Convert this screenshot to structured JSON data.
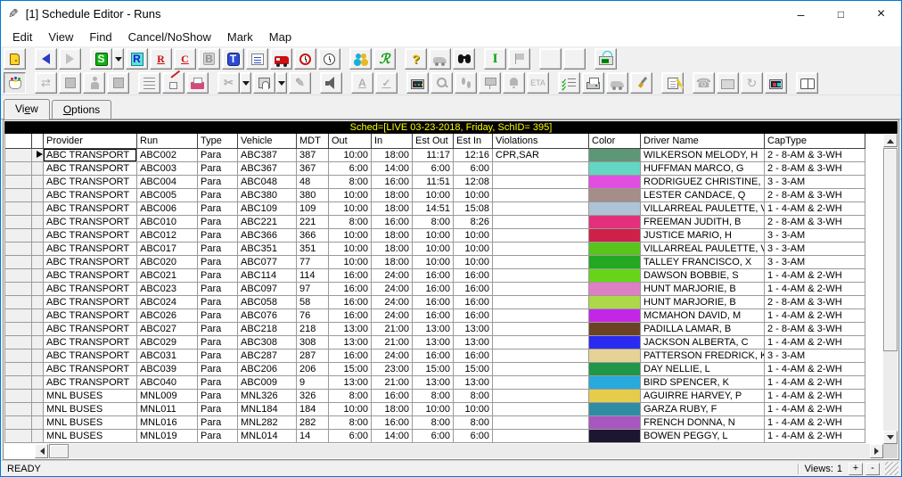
{
  "window": {
    "title": "[1] Schedule Editor - Runs",
    "controls": {
      "minimize": "–",
      "maximize": "□",
      "close": "×"
    }
  },
  "menu": [
    "Edit",
    "View",
    "Find",
    "Cancel/NoShow",
    "Mark",
    "Map"
  ],
  "toolbar_main": [
    {
      "name": "exit-button",
      "icon": "door"
    },
    {
      "name": "back-button",
      "icon": "arrow-left",
      "gap": true
    },
    {
      "name": "forward-button",
      "icon": "arrow-right",
      "enabled": false
    },
    {
      "name": "schedules-button",
      "icon": "letter-s",
      "text": "S",
      "gap": true,
      "dropdown": true
    },
    {
      "name": "runs-button",
      "icon": "letter-r-blue",
      "text": "R"
    },
    {
      "name": "run-list-button",
      "icon": "letter-r-red",
      "text": "R"
    },
    {
      "name": "cancellations-button",
      "icon": "letter-c-red",
      "text": "C"
    },
    {
      "name": "bookings-button",
      "icon": "letter-b-gray",
      "text": "B",
      "enabled": false
    },
    {
      "name": "trips-button",
      "icon": "letter-t-blue",
      "text": "T"
    },
    {
      "name": "itinerary-button",
      "icon": "list-lines"
    },
    {
      "name": "vehicles-button",
      "icon": "bus-red"
    },
    {
      "name": "alarms-button",
      "icon": "alarm-clock"
    },
    {
      "name": "clock-button",
      "icon": "clock"
    },
    {
      "name": "clients-button",
      "icon": "people",
      "gap": true
    },
    {
      "name": "reports-button",
      "icon": "script-r",
      "text": "ℛ"
    },
    {
      "name": "help-button",
      "icon": "question",
      "text": "?",
      "gap": true
    },
    {
      "name": "vehicle-locate-button",
      "icon": "car-gray",
      "enabled": false
    },
    {
      "name": "find-button",
      "icon": "binoculars"
    },
    {
      "name": "info-button",
      "icon": "letter-i-green",
      "text": "I",
      "gap": true
    },
    {
      "name": "flag-button",
      "icon": "flag-gray",
      "enabled": false
    },
    {
      "name": "fixed-route-button",
      "icon": "bus-gray",
      "enabled": false,
      "gap": true
    },
    {
      "name": "fixed-route-2-button",
      "icon": "bus-gray",
      "enabled": false
    },
    {
      "name": "mdt-button",
      "icon": "mdt-radio",
      "gap": true
    }
  ],
  "toolbar_secondary": [
    {
      "name": "color-legend-button",
      "icon": "palette",
      "pressed": true
    },
    {
      "name": "swap-button",
      "icon": "swap-arrows",
      "text": "⇄",
      "enabled": false,
      "gap": true
    },
    {
      "name": "block-button",
      "icon": "square-gray",
      "enabled": false
    },
    {
      "name": "driver-button",
      "icon": "person-gray",
      "enabled": false
    },
    {
      "name": "block-2-button",
      "icon": "square-gray",
      "enabled": false
    },
    {
      "name": "run-times-button",
      "icon": "times-list",
      "gap": true
    },
    {
      "name": "ink-button",
      "icon": "ink-pen"
    },
    {
      "name": "send-button",
      "icon": "fax-pink"
    },
    {
      "name": "cut-run-button",
      "icon": "scissors-gray",
      "text": "✂",
      "enabled": false,
      "gap": true,
      "dropdown": true
    },
    {
      "name": "save-button",
      "icon": "save",
      "dropdown": true
    },
    {
      "name": "edit-button",
      "icon": "pencil-gray",
      "text": "✎",
      "enabled": false
    },
    {
      "name": "sound-button",
      "icon": "speaker",
      "gap": true
    },
    {
      "name": "address-list-button",
      "icon": "list-a-gray",
      "text": "A",
      "enabled": false,
      "gap": true
    },
    {
      "name": "validation-button",
      "icon": "list-check-gray",
      "text": "✓",
      "enabled": false
    },
    {
      "name": "monitor-button",
      "icon": "monitor-dots",
      "gap": true
    },
    {
      "name": "zoom-button",
      "icon": "magnifier-gray",
      "enabled": false
    },
    {
      "name": "walk-button",
      "icon": "footprints-gray",
      "enabled": false
    },
    {
      "name": "stop-button",
      "icon": "signpost-gray",
      "enabled": false
    },
    {
      "name": "notify-button",
      "icon": "bell-gray",
      "enabled": false
    },
    {
      "name": "eta-button",
      "icon": "eta-text",
      "text": "ETA",
      "enabled": false
    },
    {
      "name": "checklist-button",
      "icon": "checklist",
      "gap": true
    },
    {
      "name": "print-button",
      "icon": "printer"
    },
    {
      "name": "vehicle-2-button",
      "icon": "car-gray",
      "enabled": false
    },
    {
      "name": "brush-button",
      "icon": "brush"
    },
    {
      "name": "notes-button",
      "icon": "notepad",
      "gap": true
    },
    {
      "name": "phone-button",
      "icon": "phone-gray",
      "text": "☎",
      "enabled": false,
      "gap": true
    },
    {
      "name": "monitor-2-button",
      "icon": "monitor-gray",
      "enabled": false
    },
    {
      "name": "history-button",
      "icon": "clock-arrow-gray",
      "text": "↻",
      "enabled": false
    },
    {
      "name": "map-display-button",
      "icon": "monitor-map"
    },
    {
      "name": "book-button",
      "icon": "book",
      "gap": true
    }
  ],
  "tabs": [
    {
      "label": "View",
      "selected": true,
      "accel_index": 2
    },
    {
      "label": "Options",
      "selected": false,
      "accel_index": 0
    }
  ],
  "sched_header": "Sched=[LIVE 03-23-2018, Friday, SchID= 395]",
  "grid": {
    "columns": [
      "Provider",
      "Run",
      "Type",
      "Vehicle",
      "MDT",
      "Out",
      "In",
      "Est Out",
      "Est In",
      "Violations",
      "Color",
      "Driver Name",
      "CapType"
    ],
    "current_row": 0,
    "rows": [
      [
        "ABC TRANSPORT",
        "ABC002",
        "Para",
        "ABC387",
        "387",
        "10:00",
        "18:00",
        "11:17",
        "12:16",
        "CPR,SAR",
        "#5E9678",
        "WILKERSON MELODY, H",
        "2 - 8-AM & 3-WH"
      ],
      [
        "ABC TRANSPORT",
        "ABC003",
        "Para",
        "ABC367",
        "367",
        "6:00",
        "14:00",
        "6:00",
        "6:00",
        "",
        "#63D6C4",
        "HUFFMAN MARCO, G",
        "2 - 8-AM & 3-WH"
      ],
      [
        "ABC TRANSPORT",
        "ABC004",
        "Para",
        "ABC048",
        "48",
        "8:00",
        "16:00",
        "11:51",
        "12:08",
        "",
        "#E04FE0",
        "RODRIGUEZ CHRISTINE, I",
        "3 - 3-AM"
      ],
      [
        "ABC TRANSPORT",
        "ABC005",
        "Para",
        "ABC380",
        "380",
        "10:00",
        "18:00",
        "10:00",
        "10:00",
        "",
        "#A58D88",
        "LESTER CANDACE, Q",
        "2 - 8-AM & 3-WH"
      ],
      [
        "ABC TRANSPORT",
        "ABC006",
        "Para",
        "ABC109",
        "109",
        "10:00",
        "18:00",
        "14:51",
        "15:08",
        "",
        "#AEC4D6",
        "VILLARREAL PAULETTE, V",
        "1 - 4-AM & 2-WH"
      ],
      [
        "ABC TRANSPORT",
        "ABC010",
        "Para",
        "ABC221",
        "221",
        "8:00",
        "16:00",
        "8:00",
        "8:26",
        "",
        "#E3307D",
        "FREEMAN JUDITH, B",
        "2 - 8-AM & 3-WH"
      ],
      [
        "ABC TRANSPORT",
        "ABC012",
        "Para",
        "ABC366",
        "366",
        "10:00",
        "18:00",
        "10:00",
        "10:00",
        "",
        "#CE2048",
        "JUSTICE MARIO, H",
        "3 - 3-AM"
      ],
      [
        "ABC TRANSPORT",
        "ABC017",
        "Para",
        "ABC351",
        "351",
        "10:00",
        "18:00",
        "10:00",
        "10:00",
        "",
        "#58C41C",
        "VILLARREAL PAULETTE, V",
        "3 - 3-AM"
      ],
      [
        "ABC TRANSPORT",
        "ABC020",
        "Para",
        "ABC077",
        "77",
        "10:00",
        "18:00",
        "10:00",
        "10:00",
        "",
        "#22A822",
        "TALLEY FRANCISCO, X",
        "3 - 3-AM"
      ],
      [
        "ABC TRANSPORT",
        "ABC021",
        "Para",
        "ABC114",
        "114",
        "16:00",
        "24:00",
        "16:00",
        "16:00",
        "",
        "#66D517",
        "DAWSON BOBBIE, S",
        "1 - 4-AM & 2-WH"
      ],
      [
        "ABC TRANSPORT",
        "ABC023",
        "Para",
        "ABC097",
        "97",
        "16:00",
        "24:00",
        "16:00",
        "16:00",
        "",
        "#DE7FC4",
        "HUNT MARJORIE, B",
        "1 - 4-AM & 2-WH"
      ],
      [
        "ABC TRANSPORT",
        "ABC024",
        "Para",
        "ABC058",
        "58",
        "16:00",
        "24:00",
        "16:00",
        "16:00",
        "",
        "#ABD94A",
        "HUNT MARJORIE, B",
        "2 - 8-AM & 3-WH"
      ],
      [
        "ABC TRANSPORT",
        "ABC026",
        "Para",
        "ABC076",
        "76",
        "16:00",
        "24:00",
        "16:00",
        "16:00",
        "",
        "#C426E8",
        "MCMAHON DAVID, M",
        "1 - 4-AM & 2-WH"
      ],
      [
        "ABC TRANSPORT",
        "ABC027",
        "Para",
        "ABC218",
        "218",
        "13:00",
        "21:00",
        "13:00",
        "13:00",
        "",
        "#6B4226",
        "PADILLA LAMAR, B",
        "2 - 8-AM & 3-WH"
      ],
      [
        "ABC TRANSPORT",
        "ABC029",
        "Para",
        "ABC308",
        "308",
        "13:00",
        "21:00",
        "13:00",
        "13:00",
        "",
        "#2A2AF0",
        "JACKSON ALBERTA, C",
        "1 - 4-AM & 2-WH"
      ],
      [
        "ABC TRANSPORT",
        "ABC031",
        "Para",
        "ABC287",
        "287",
        "16:00",
        "24:00",
        "16:00",
        "16:00",
        "",
        "#E5D294",
        "PATTERSON FREDRICK, K",
        "3 - 3-AM"
      ],
      [
        "ABC TRANSPORT",
        "ABC039",
        "Para",
        "ABC206",
        "206",
        "15:00",
        "23:00",
        "15:00",
        "15:00",
        "",
        "#209648",
        "DAY NELLIE, L",
        "1 - 4-AM & 2-WH"
      ],
      [
        "ABC TRANSPORT",
        "ABC040",
        "Para",
        "ABC009",
        "9",
        "13:00",
        "21:00",
        "13:00",
        "13:00",
        "",
        "#28AADC",
        "BIRD SPENCER, K",
        "1 - 4-AM & 2-WH"
      ],
      [
        "MNL BUSES",
        "MNL009",
        "Para",
        "MNL326",
        "326",
        "8:00",
        "16:00",
        "8:00",
        "8:00",
        "",
        "#E6CC4A",
        "AGUIRRE HARVEY, P",
        "1 - 4-AM & 2-WH"
      ],
      [
        "MNL BUSES",
        "MNL011",
        "Para",
        "MNL184",
        "184",
        "10:00",
        "18:00",
        "10:00",
        "10:00",
        "",
        "#2E8CA3",
        "GARZA RUBY, F",
        "1 - 4-AM & 2-WH"
      ],
      [
        "MNL BUSES",
        "MNL016",
        "Para",
        "MNL282",
        "282",
        "8:00",
        "16:00",
        "8:00",
        "8:00",
        "",
        "#A757BF",
        "FRENCH DONNA, N",
        "1 - 4-AM & 2-WH"
      ],
      [
        "MNL BUSES",
        "MNL019",
        "Para",
        "MNL014",
        "14",
        "6:00",
        "14:00",
        "6:00",
        "6:00",
        "",
        "#1C1630",
        "BOWEN PEGGY, L",
        "1 - 4-AM & 2-WH"
      ]
    ]
  },
  "status": {
    "ready": "READY",
    "views_label": "Views:",
    "views_value": "1",
    "views_plus": "+",
    "views_minus": "-"
  },
  "colors": {
    "accent": "#0077d7",
    "sched_bar_bg": "#000000",
    "sched_bar_text": "#ffff00"
  }
}
